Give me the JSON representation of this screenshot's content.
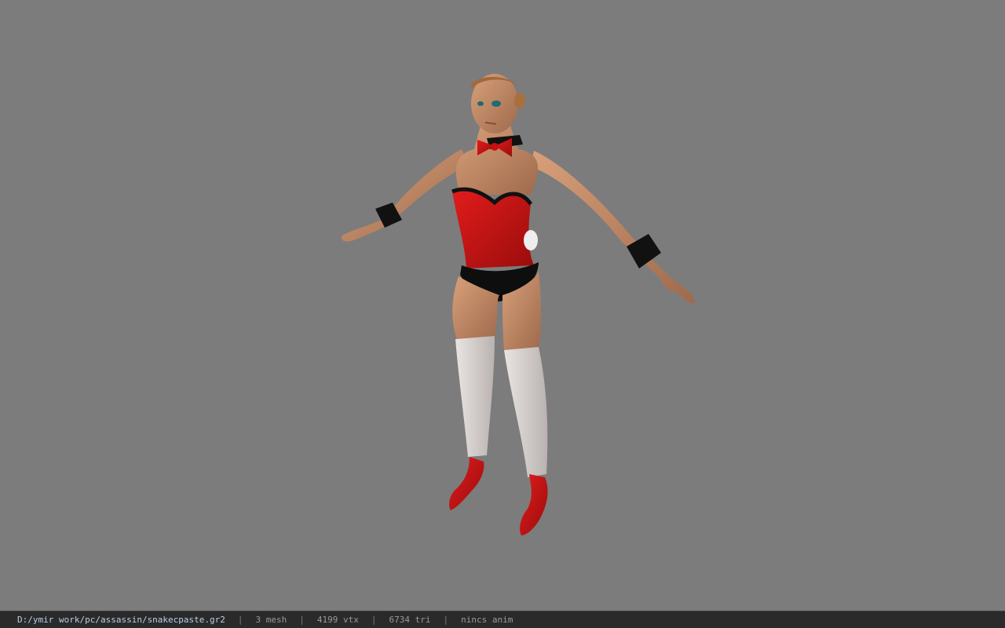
{
  "viewport": {
    "background": "#7c7c7c",
    "model": "bunny-costume-character-icon"
  },
  "status_bar": {
    "file_path": "D:/ymir work/pc/assassin/snakecpaste.gr2",
    "separator": "|",
    "mesh_count": "3 mesh",
    "vertex_count": "4199 vtx",
    "triangle_count": "6734 tri",
    "anim": "nincs anim"
  }
}
